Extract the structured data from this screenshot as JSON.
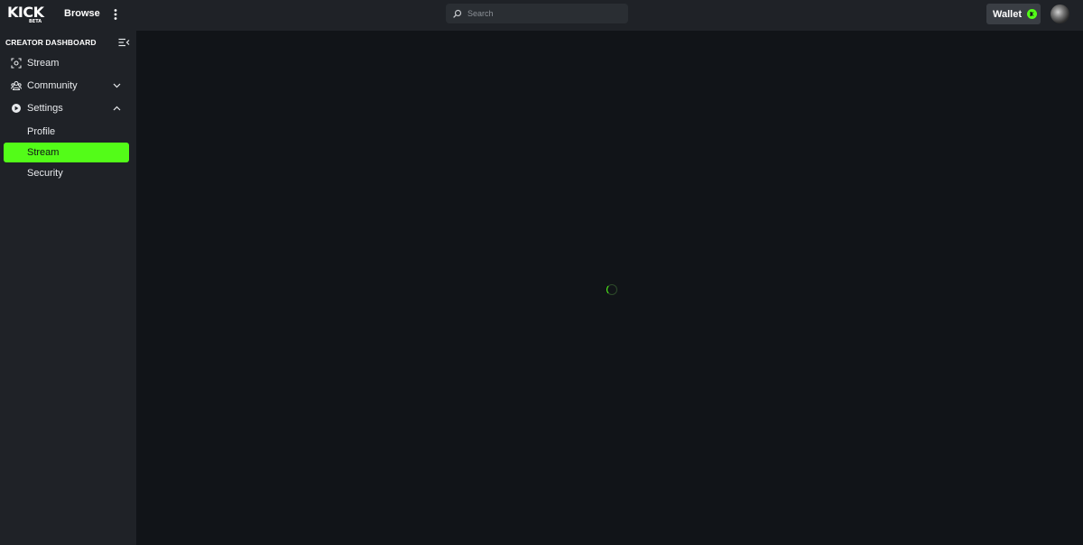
{
  "topbar": {
    "logo_text": "KICK",
    "logo_badge": "BETA",
    "browse_label": "Browse",
    "search_placeholder": "Search",
    "wallet_label": "Wallet"
  },
  "sidebar": {
    "title": "CREATOR DASHBOARD",
    "items": [
      {
        "label": "Stream",
        "icon": "stream-icon"
      },
      {
        "label": "Community",
        "icon": "community-icon",
        "expanded": false
      },
      {
        "label": "Settings",
        "icon": "settings-icon",
        "expanded": true
      }
    ],
    "settings_subitems": [
      {
        "label": "Profile",
        "active": false
      },
      {
        "label": "Stream",
        "active": true
      },
      {
        "label": "Security",
        "active": false
      }
    ]
  },
  "colors": {
    "accent": "#53fc18",
    "topbar_bg": "#1f2227",
    "sidebar_bg": "#1f2227",
    "main_bg": "#111418"
  },
  "main": {
    "state": "loading"
  }
}
